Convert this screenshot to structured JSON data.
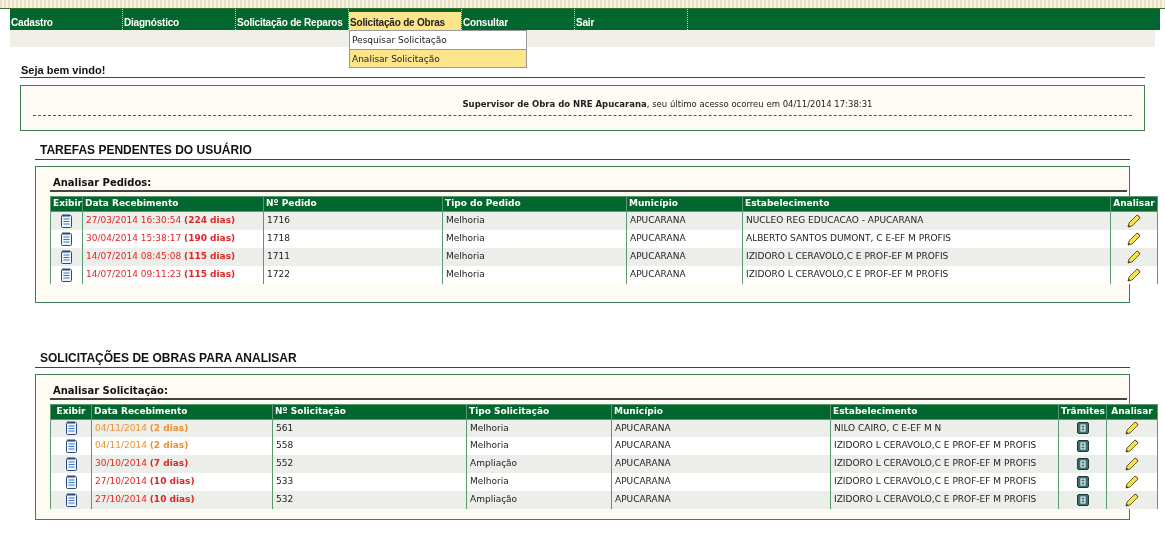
{
  "menu": [
    {
      "label": "Cadastro",
      "selected": false
    },
    {
      "label": "Diagnóstico",
      "selected": false
    },
    {
      "label": "Solicitação de Reparos",
      "selected": false
    },
    {
      "label": "Solicitação de Obras",
      "selected": true
    },
    {
      "label": "Consultar",
      "selected": false
    },
    {
      "label": "Sair",
      "selected": false
    }
  ],
  "dropdown": [
    {
      "label": "Pesquisar Solicitação",
      "selected": false
    },
    {
      "label": "Analisar Solicitação",
      "selected": true
    }
  ],
  "welcome": "Seja bem vindo!",
  "last_access": "**Supervisor de Obra do NRE Apucarana**, seu último acesso ocorreu em 04/11/2014 17:38:31",
  "sections": [
    {
      "title": "TAREFAS PENDENTES DO USUÁRIO",
      "subtitle": "Analisar Pedidos:",
      "columns": [
        "Exibir",
        "Data Recebimento",
        "Nº Pedido",
        "Tipo do Pedido",
        "Município",
        "Estabelecimento",
        "Analisar"
      ],
      "rows": [
        {
          "date": "27/03/2014 16:30:54",
          "age": "(224 dias)",
          "color": "#e02626",
          "number": "1716",
          "type": "Melhoria",
          "city": "APUCARANA",
          "school": "NUCLEO REG EDUCACAO - APUCARANA"
        },
        {
          "date": "30/04/2014 15:38:17",
          "age": "(190 dias)",
          "color": "#e02626",
          "number": "1718",
          "type": "Melhoria",
          "city": "APUCARANA",
          "school": "ALBERTO SANTOS DUMONT, C E-EF M PROFIS"
        },
        {
          "date": "14/07/2014 08:45:08",
          "age": "(115 dias)",
          "color": "#e02626",
          "number": "1711",
          "type": "Melhoria",
          "city": "APUCARANA",
          "school": "IZIDORO L CERAVOLO,C E PROF-EF M PROFIS"
        },
        {
          "date": "14/07/2014 09:11:23",
          "age": "(115 dias)",
          "color": "#e02626",
          "number": "1722",
          "type": "Melhoria",
          "city": "APUCARANA",
          "school": "IZIDORO L CERAVOLO,C E PROF-EF M PROFIS"
        }
      ]
    },
    {
      "title": "SOLICITAÇÕES DE OBRAS PARA ANALISAR",
      "subtitle": "Analisar Solicitação:",
      "columns": [
        "Exibir",
        "Data Recebimento",
        "Nº Solicitação",
        "Tipo Solicitação",
        "Município",
        "Estabelecimento",
        "Trâmites",
        "Analisar"
      ],
      "rows": [
        {
          "date": "04/11/2014",
          "age": "(2 dias)",
          "color": "#f0902e",
          "number": "561",
          "type": "Melhoria",
          "city": "APUCARANA",
          "school": "NILO CAIRO, C E-EF M N"
        },
        {
          "date": "04/11/2014",
          "age": "(2 dias)",
          "color": "#f0902e",
          "number": "558",
          "type": "Melhoria",
          "city": "APUCARANA",
          "school": "IZIDORO L CERAVOLO,C E PROF-EF M PROFIS"
        },
        {
          "date": "30/10/2014",
          "age": "(7 dias)",
          "color": "#e02626",
          "number": "552",
          "type": "Ampliação",
          "city": "APUCARANA",
          "school": "IZIDORO L CERAVOLO,C E PROF-EF M PROFIS"
        },
        {
          "date": "27/10/2014",
          "age": "(10 dias)",
          "color": "#e02626",
          "number": "533",
          "type": "Melhoria",
          "city": "APUCARANA",
          "school": "IZIDORO L CERAVOLO,C E PROF-EF M PROFIS"
        },
        {
          "date": "27/10/2014",
          "age": "(10 dias)",
          "color": "#e02626",
          "number": "532",
          "type": "Ampliação",
          "city": "APUCARANA",
          "school": "IZIDORO L CERAVOLO,C E PROF-EF M PROFIS"
        }
      ]
    }
  ]
}
